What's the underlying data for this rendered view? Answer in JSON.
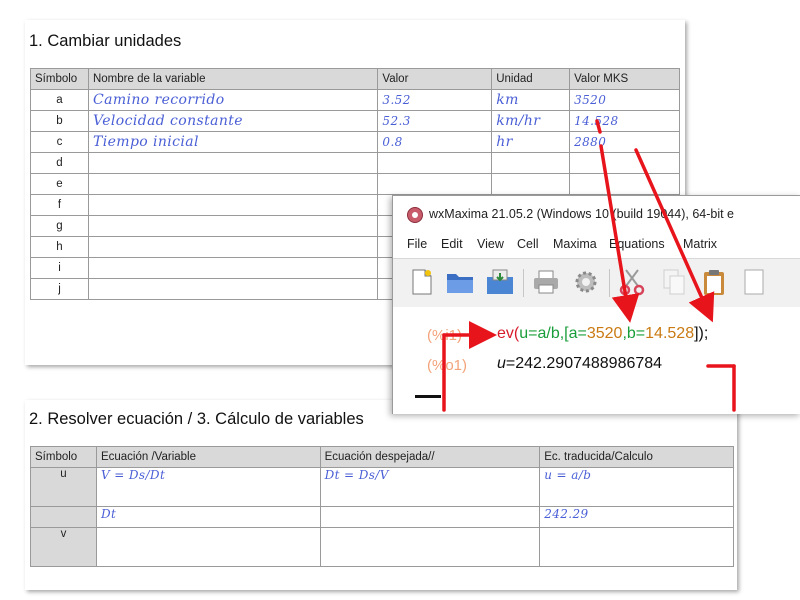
{
  "section1": {
    "title": "1. Cambiar unidades",
    "headers": [
      "Símbolo",
      "Nombre de la variable",
      "Valor",
      "Unidad",
      "Valor MKS"
    ],
    "rows": [
      {
        "sym": "a",
        "name": "Camino recorrido",
        "value": "3.52",
        "unit": "km",
        "mks": "3520"
      },
      {
        "sym": "b",
        "name": "Velocidad constante",
        "value": "52.3",
        "unit": "km/hr",
        "mks": "14.528"
      },
      {
        "sym": "c",
        "name": "Tiempo inicial",
        "value": "0.8",
        "unit": "hr",
        "mks": "2880"
      },
      {
        "sym": "d",
        "name": "",
        "value": "",
        "unit": "",
        "mks": ""
      },
      {
        "sym": "e",
        "name": "",
        "value": "",
        "unit": "",
        "mks": ""
      },
      {
        "sym": "f",
        "name": "",
        "value": "",
        "unit": "",
        "mks": ""
      },
      {
        "sym": "g",
        "name": "",
        "value": "",
        "unit": "",
        "mks": ""
      },
      {
        "sym": "h",
        "name": "",
        "value": "",
        "unit": "",
        "mks": ""
      },
      {
        "sym": "i",
        "name": "",
        "value": "",
        "unit": "",
        "mks": ""
      },
      {
        "sym": "j",
        "name": "",
        "value": "",
        "unit": "",
        "mks": ""
      }
    ]
  },
  "section2": {
    "title": "2. Resolver ecuación / 3. Cálculo de variables",
    "headers": [
      "Símbolo",
      "Ecuación /Variable",
      "Ecuación despejada//",
      "Ec. traducida/Calculo"
    ],
    "rows": [
      {
        "sym": "u",
        "eq": "V = Ds/Dt",
        "solved": "Dt = Ds/V",
        "calc": "u = a/b"
      },
      {
        "sym": "",
        "eq": "Dt",
        "solved": "",
        "calc": "242.29"
      },
      {
        "sym": "v",
        "eq": "",
        "solved": "",
        "calc": ""
      }
    ]
  },
  "wxmaxima": {
    "title": "wxMaxima 21.05.2 (Windows 10 (build 19044), 64-bit e",
    "menu": [
      "File",
      "Edit",
      "View",
      "Cell",
      "Maxima",
      "Equations",
      "Matrix"
    ],
    "toolbar_icons": [
      "new-document-icon",
      "open-folder-icon",
      "save-icon",
      "print-icon",
      "settings-gear-icon",
      "cut-scissors-icon",
      "copy-icon",
      "paste-clipboard-icon"
    ],
    "input_label": "(%i1)",
    "output_label": "(%o1)",
    "input": {
      "fn": "ev(",
      "expr": "u=a/b",
      "list_open": ",[",
      "a_eq": "a=",
      "a_val": "3520",
      "comma": ",",
      "b_eq": "b=",
      "b_val": "14.528",
      "close": "]);"
    },
    "output": {
      "var": "u",
      "eq": "=",
      "value": "242.2907488986784"
    }
  },
  "colors": {
    "handwriting": "#4a5fd6",
    "arrow": "#e8141c",
    "maxima_label": "#f3a37a",
    "maxima_green": "#1a9e3a",
    "maxima_number": "#c97a12",
    "header_gray": "#d9d9d9"
  }
}
